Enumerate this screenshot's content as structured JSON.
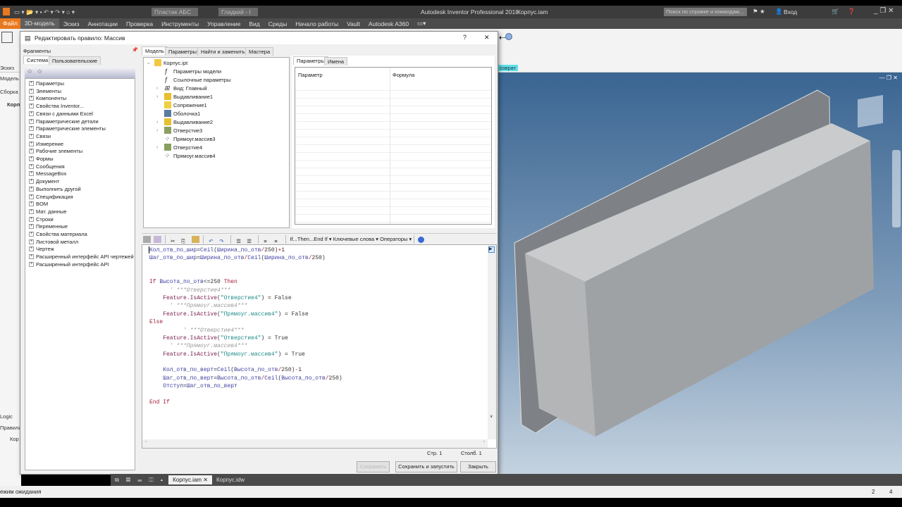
{
  "app": {
    "title": "Autodesk Inventor Professional 2018",
    "document": "Корпус.iam",
    "material": "Пластик АБС",
    "appearance": "Гладкий - I",
    "search_placeholder": "Поиск по справке и командам...",
    "signin": "Вход"
  },
  "ribbon": {
    "tabs": [
      "Файл",
      "3D-модель",
      "Эскиз",
      "Аннотации",
      "Проверка",
      "Инструменты",
      "Управление",
      "Вид",
      "Среды",
      "Начало работы",
      "Vault",
      "Autodesk A360"
    ],
    "return_label": "озврат"
  },
  "browser": {
    "labels": [
      "Эскиз",
      "Модель",
      "Сборка",
      "Корп"
    ],
    "logic_tab": "Logic",
    "rules_label": "Правила",
    "rule_item": "Кор"
  },
  "dialog": {
    "title": "Редактировать правило: Массив",
    "close": "✕",
    "help": "?",
    "fragments": {
      "header": "Фрагменты",
      "tabs": [
        "Система",
        "Пользовательские"
      ],
      "items": [
        "Параметры",
        "Элементы",
        "Компоненты",
        "Свойства Inventor...",
        "Связи с данными Excel",
        "Параметрические детали",
        "Параметрические элементы",
        "Связи",
        "Измерение",
        "Рабочие элементы",
        "Формы",
        "Сообщения",
        "MessageBox",
        "Документ",
        "Выполнить другой",
        "Спецификация",
        "BOM",
        "Мат. данные",
        "Строки",
        "Переменные",
        "Свойства материала",
        "Листовой металл",
        "Чертеж",
        "Расширенный интерфейс API чертежей",
        "Расширенный интерфейс API"
      ]
    },
    "main_tabs": [
      "Модель",
      "Параметры",
      "Найти и заменить",
      "Мастера"
    ],
    "model_tree": [
      {
        "label": "Корпус.ipt",
        "icon": "part-icon",
        "expander": "open",
        "indent": 0
      },
      {
        "label": "Параметры модели",
        "icon": "fx-icon",
        "expander": "",
        "indent": 1
      },
      {
        "label": "Ссылочные параметры",
        "icon": "fx-icon",
        "expander": "",
        "indent": 1
      },
      {
        "label": "Вид: Главный",
        "icon": "view-icon",
        "expander": "closed",
        "indent": 1
      },
      {
        "label": "Выдавливание1",
        "icon": "extrude-icon",
        "expander": "closed",
        "indent": 1
      },
      {
        "label": "Сопряжение1",
        "icon": "fillet-icon",
        "expander": "",
        "indent": 1
      },
      {
        "label": "Оболочка1",
        "icon": "shell-icon",
        "expander": "",
        "indent": 1
      },
      {
        "label": "Выдавливание2",
        "icon": "extrude-icon",
        "expander": "closed",
        "indent": 1
      },
      {
        "label": "Отверстие3",
        "icon": "hole-icon",
        "expander": "closed",
        "indent": 1
      },
      {
        "label": "Прямоуг.массив3",
        "icon": "pattern-icon",
        "expander": "",
        "indent": 1
      },
      {
        "label": "Отверстие4",
        "icon": "hole-icon",
        "expander": "closed",
        "indent": 1
      },
      {
        "label": "Прямоуг.массив4",
        "icon": "pattern-icon",
        "expander": "",
        "indent": 1
      }
    ],
    "params_tabs": [
      "Параметры",
      "Имена"
    ],
    "params_columns": [
      "Параметр",
      "Формула"
    ],
    "editor_toolbar": {
      "if_then": "If...Then...End If",
      "keywords": "Ключевые слова",
      "operators": "Операторы"
    },
    "code_lines": [
      [
        [
          "v",
          "Кол_отв_по_шир"
        ],
        [
          "n",
          "="
        ],
        [
          "v",
          "Ceil"
        ],
        [
          "n",
          "("
        ],
        [
          "v",
          "Ширина_по_отв"
        ],
        [
          "o",
          "/"
        ],
        [
          "n",
          "250)"
        ],
        [
          "o",
          "+"
        ],
        [
          "n",
          "1"
        ]
      ],
      [
        [
          "v",
          "Шаг_отв_по_шир"
        ],
        [
          "n",
          "="
        ],
        [
          "v",
          "Ширина_по_отв"
        ],
        [
          "o",
          "/"
        ],
        [
          "v",
          "Ceil"
        ],
        [
          "n",
          "("
        ],
        [
          "v",
          "Ширина_по_отв"
        ],
        [
          "o",
          "/"
        ],
        [
          "n",
          "250)"
        ]
      ],
      [],
      [],
      [
        [
          "k",
          "If "
        ],
        [
          "v",
          "Высота_по_отв"
        ],
        [
          "n",
          "<=250 "
        ],
        [
          "k",
          "Then"
        ]
      ],
      [
        [
          "c",
          "      ' ***Отверстие4***"
        ]
      ],
      [
        [
          "n",
          "    "
        ],
        [
          "f",
          "Feature.IsActive"
        ],
        [
          "n",
          "("
        ],
        [
          "s",
          "\"Отверстие4\""
        ],
        [
          "n",
          ") = False"
        ]
      ],
      [
        [
          "c",
          "      ' ***Прямоуг.массив4***"
        ]
      ],
      [
        [
          "n",
          "    "
        ],
        [
          "f",
          "Feature.IsActive"
        ],
        [
          "n",
          "("
        ],
        [
          "s",
          "\"Прямоуг.массив4\""
        ],
        [
          "n",
          ") = False"
        ]
      ],
      [
        [
          "k",
          "Else"
        ]
      ],
      [
        [
          "c",
          "          ' ***Отверстие4***"
        ]
      ],
      [
        [
          "n",
          "    "
        ],
        [
          "f",
          "Feature.IsActive"
        ],
        [
          "n",
          "("
        ],
        [
          "s",
          "\"Отверстие4\""
        ],
        [
          "n",
          ") = True"
        ]
      ],
      [
        [
          "c",
          "      ' ***Прямоуг.массив4***"
        ]
      ],
      [
        [
          "n",
          "    "
        ],
        [
          "f",
          "Feature.IsActive"
        ],
        [
          "n",
          "("
        ],
        [
          "s",
          "\"Прямоуг.массив4\""
        ],
        [
          "n",
          ") = True"
        ]
      ],
      [],
      [
        [
          "n",
          "    "
        ],
        [
          "v",
          "Кол_отв_по_верт"
        ],
        [
          "n",
          "="
        ],
        [
          "v",
          "Ceil"
        ],
        [
          "n",
          "("
        ],
        [
          "v",
          "Высота_по_отв"
        ],
        [
          "o",
          "/"
        ],
        [
          "n",
          "250)"
        ],
        [
          "o",
          "-"
        ],
        [
          "n",
          "1"
        ]
      ],
      [
        [
          "n",
          "    "
        ],
        [
          "v",
          "Шаг_отв_по_верт"
        ],
        [
          "n",
          "="
        ],
        [
          "v",
          "Высота_по_отв"
        ],
        [
          "o",
          "/"
        ],
        [
          "v",
          "Ceil"
        ],
        [
          "n",
          "("
        ],
        [
          "v",
          "Высота_по_отв"
        ],
        [
          "o",
          "/"
        ],
        [
          "n",
          "250)"
        ]
      ],
      [
        [
          "n",
          "    "
        ],
        [
          "v",
          "Отступ"
        ],
        [
          "n",
          "="
        ],
        [
          "v",
          "Шаг_отв_по_верт"
        ]
      ],
      [],
      [
        [
          "k",
          "End If"
        ]
      ]
    ],
    "status": {
      "line": "Стр. 1",
      "col": "Столб. 1"
    },
    "buttons": {
      "save": "Сохранить",
      "save_run": "Сохранить и запустить",
      "close": "Закрыть"
    }
  },
  "doc_tabs": [
    "Корпус.iam",
    "Корпус.idw"
  ],
  "statusbar": {
    "text": "ежим ожидания",
    "n1": "2",
    "n2": "4"
  },
  "colors": {
    "file_tab": "#e8791f",
    "viewport_top": "#3a6592",
    "return_badge": "#5ee0e8"
  }
}
